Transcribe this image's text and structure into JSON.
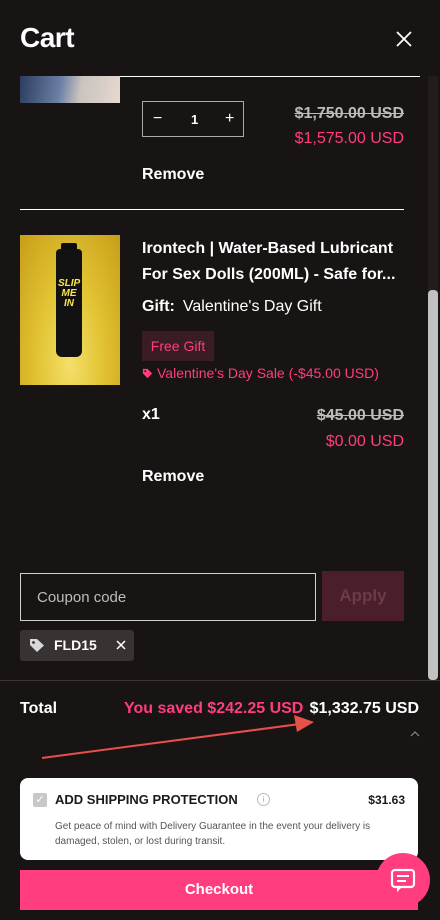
{
  "header": {
    "title": "Cart"
  },
  "item1": {
    "quantity": "1",
    "minus": "−",
    "plus": "+",
    "price_old": "$1,750.00 USD",
    "price_new": "$1,575.00 USD",
    "remove": "Remove"
  },
  "item2": {
    "name": "Irontech | Water-Based Lubricant For Sex Dolls (200ML) - Safe for...",
    "gift_label": "Gift:",
    "gift_value": "Valentine's Day Gift",
    "free_gift": "Free Gift",
    "sale_badge": "Valentine's Day Sale (-$45.00 USD)",
    "quantity": "x1",
    "price_old": "$45.00 USD",
    "price_new": "$0.00 USD",
    "remove": "Remove",
    "image_text": "SLIP ME IN"
  },
  "coupon": {
    "placeholder": "Coupon code",
    "apply": "Apply",
    "applied_code": "FLD15"
  },
  "totals": {
    "label": "Total",
    "saved": "You saved $242.25 USD",
    "total": "$1,332.75 USD"
  },
  "shipping_protection": {
    "title": "ADD SHIPPING PROTECTION",
    "price": "$31.63",
    "description": "Get peace of mind with Delivery Guarantee in the event your delivery is damaged, stolen, or lost during transit."
  },
  "checkout": {
    "label": "Checkout"
  },
  "icons": [
    "close-icon",
    "tag-icon",
    "info-icon",
    "check-icon",
    "chat-icon",
    "chevron-up-icon"
  ],
  "colors": {
    "background": "#191414",
    "accent": "#ff3d7f",
    "apply_bg": "#4a1e2a",
    "annotation_arrow": "#e8504a"
  }
}
